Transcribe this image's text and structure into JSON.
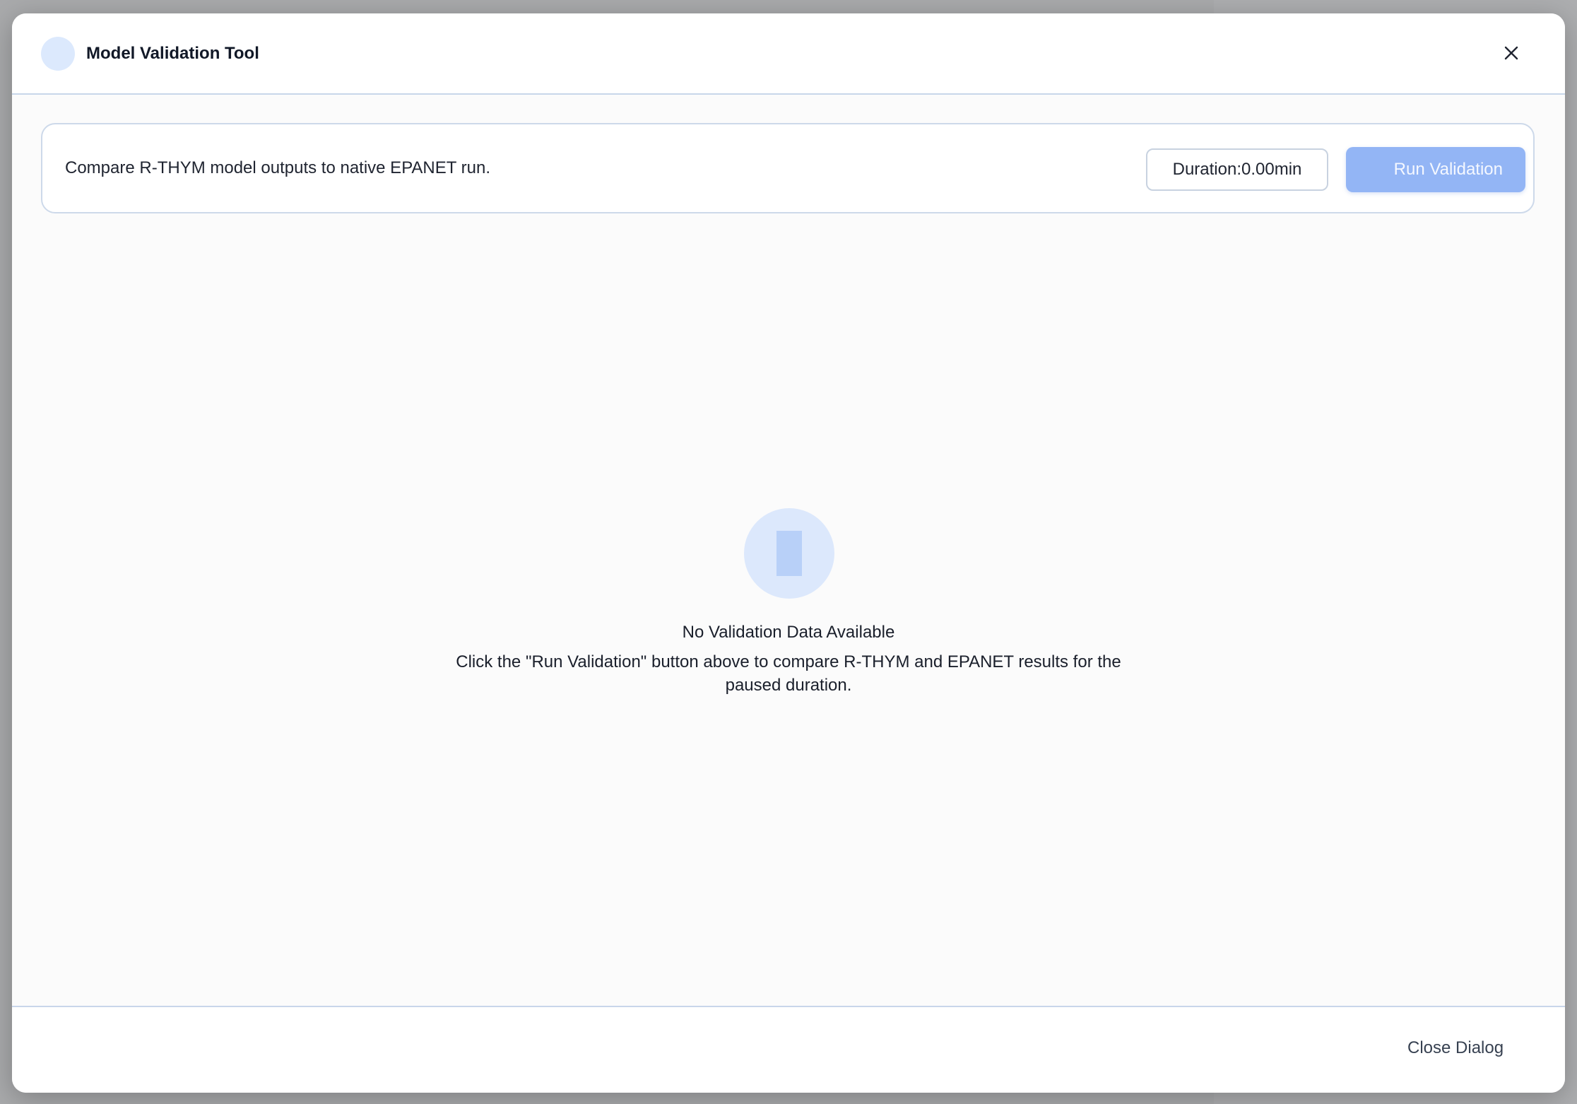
{
  "dialog": {
    "title": "Model Validation Tool",
    "description": "Compare R-THYM model outputs to native EPANET run.",
    "duration": {
      "label": "Duration:",
      "value": "0.00",
      "unit": "min"
    },
    "run_button_label": "Run Validation",
    "empty_state": {
      "title": "No Validation Data Available",
      "message": "Click the \"Run Validation\" button above to compare R-THYM and EPANET results for the paused duration."
    },
    "footer": {
      "close_label": "Close Dialog"
    }
  },
  "icons": {
    "header": "validation-icon",
    "close": "close-icon",
    "empty_state": "chart-placeholder-icon"
  },
  "colors": {
    "accent": "#93b5f5",
    "icon_bg": "#dce9fd",
    "border": "#c8d6ea"
  }
}
